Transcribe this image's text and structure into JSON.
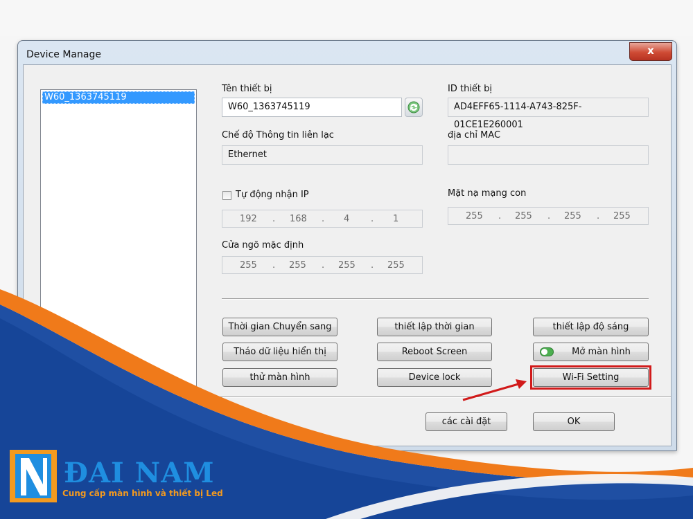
{
  "window": {
    "title": "Device Manage",
    "close_label": "x"
  },
  "device_list": {
    "items": [
      "W60_1363745119"
    ]
  },
  "form": {
    "device_name_label": "Tên thiết bị",
    "device_name_value": "W60_1363745119",
    "device_id_label": "ID thiết bị",
    "device_id_value": "AD4EFF65-1114-A743-825F-01CE1E260001",
    "comm_mode_label": "Chế độ Thông tin liên lạc",
    "comm_mode_value": "Ethernet",
    "mac_label": "địa chỉ MAC",
    "mac_value": "",
    "auto_ip_label": "Tự động nhận IP",
    "auto_ip_checked": false,
    "ip": [
      "192",
      "168",
      "4",
      "1"
    ],
    "subnet_label": "Mặt nạ mạng con",
    "subnet": [
      "255",
      "255",
      "255",
      "255"
    ],
    "gateway_label": "Cửa ngõ mặc định",
    "gateway": [
      "255",
      "255",
      "255",
      "255"
    ]
  },
  "buttons": {
    "switch_time": "Thời gian Chuyển sang",
    "set_time": "thiết lập thời gian",
    "set_brightness": "thiết lập độ sáng",
    "remove_display_data": "Tháo dữ liệu hiển thị",
    "reboot_screen": "Reboot Screen",
    "open_screen": "Mở màn hình",
    "test_screen": "thử màn hình",
    "device_lock": "Device lock",
    "wifi_setting": "Wi-Fi Setting",
    "settings": "các cài đặt",
    "ok": "OK"
  },
  "branding": {
    "logo_text": "ĐAI NAM",
    "slogan": "Cung cấp màn hình và thiết bị Led"
  },
  "colors": {
    "highlight": "#d11a1a",
    "selection": "#3399ff",
    "orange_swoosh": "#f07a1a",
    "blue_swoosh": "#1f4fa3"
  }
}
